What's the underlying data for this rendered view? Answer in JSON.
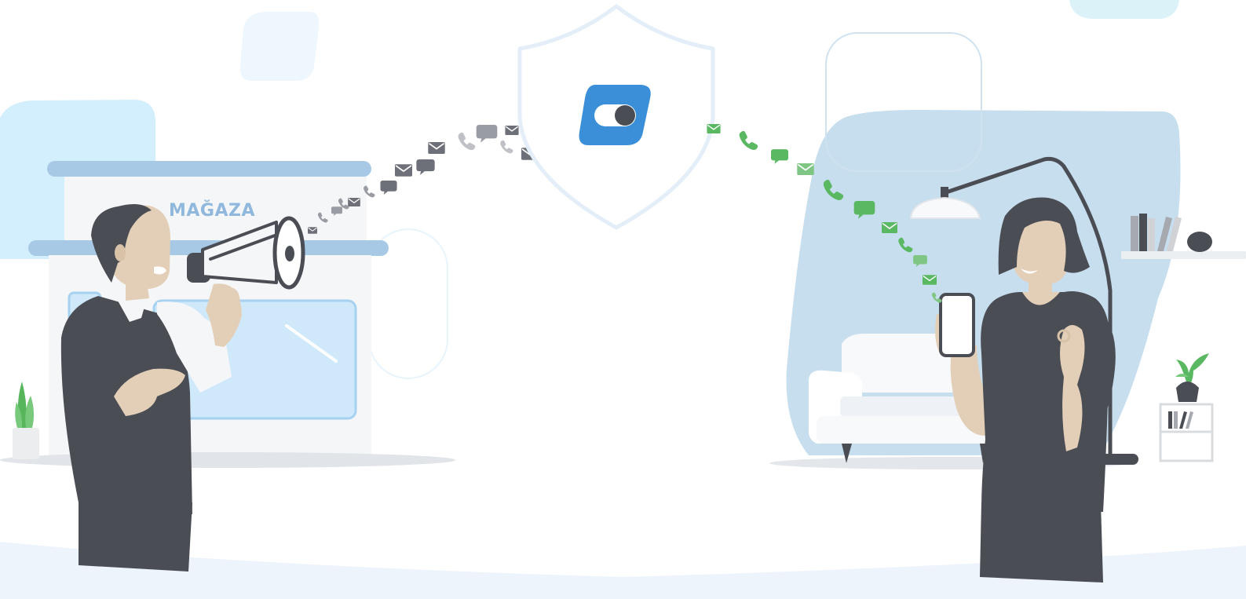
{
  "scene": {
    "store_sign": "MAĞAZA",
    "colors": {
      "dark": "#4b4d55",
      "skin": "#e3cfb7",
      "light_blue": "#d3eefc",
      "room_blue": "#c7deee",
      "toggle_blue": "#3b8fd9",
      "shield_stroke": "#e4eef8",
      "gray_icons": "#6e7079",
      "green_icons": "#5ab862"
    },
    "icons": {
      "left_stream": [
        "envelope-icon",
        "phone-icon",
        "chat-icon"
      ],
      "right_stream": [
        "envelope-icon",
        "phone-icon",
        "chat-icon"
      ],
      "center": "toggle-switch-icon"
    }
  }
}
